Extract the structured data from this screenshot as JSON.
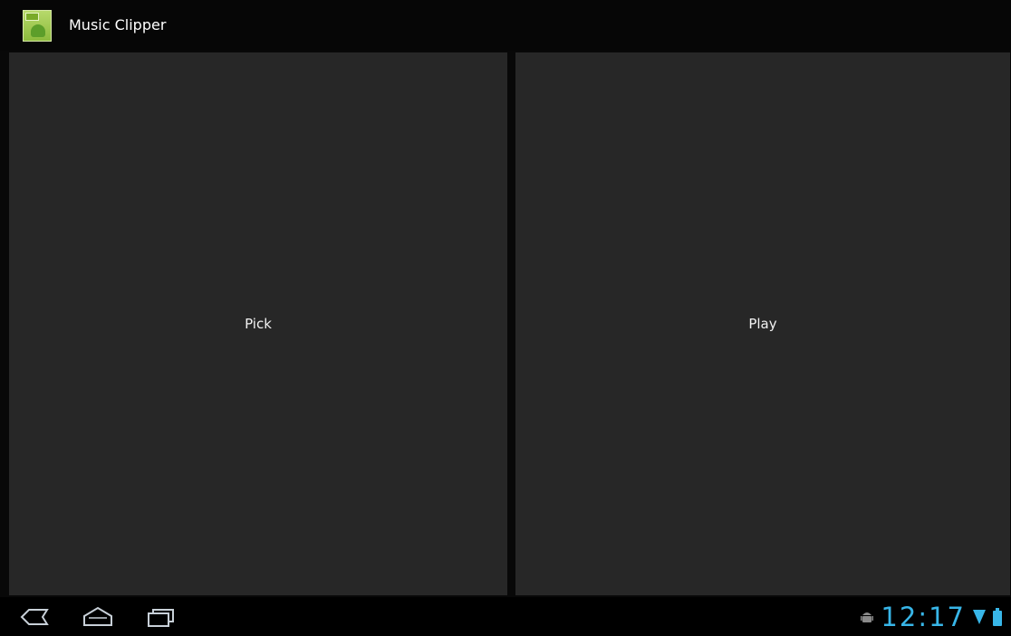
{
  "app": {
    "title": "Music Clipper"
  },
  "main": {
    "pick_label": "Pick",
    "play_label": "Play"
  },
  "status": {
    "time": "12:17"
  },
  "icons": {
    "app": "android-app-icon",
    "back": "back-icon",
    "home": "home-icon",
    "recent": "recent-apps-icon",
    "debug": "android-debug-icon",
    "wifi": "wifi-icon",
    "battery": "battery-icon"
  },
  "colors": {
    "accent": "#38b6e8",
    "panel": "#272727",
    "background": "#050505"
  }
}
